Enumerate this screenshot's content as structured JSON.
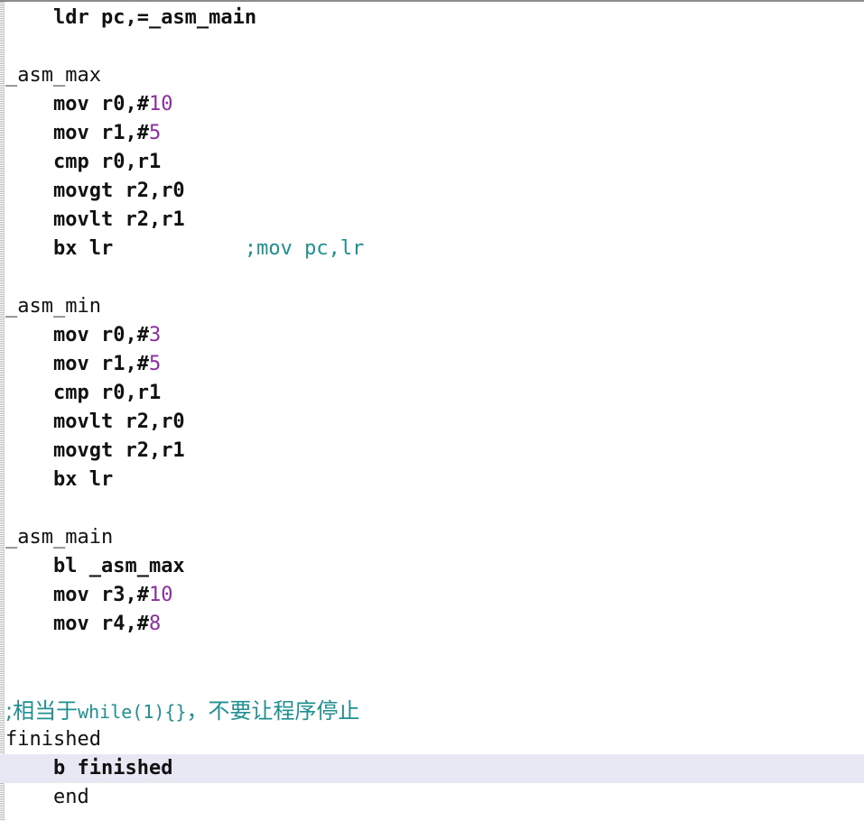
{
  "editor": {
    "colors": {
      "text": "#111111",
      "number": "#8b2fa0",
      "comment": "#1f8f8f",
      "current_line_bg": "#e8e8f5"
    },
    "lines": [
      {
        "indent": "    ",
        "code": "ldr pc,=_asm_main"
      },
      {
        "indent": "",
        "code": ""
      },
      {
        "indent": "",
        "label": "_asm_max"
      },
      {
        "indent": "    ",
        "code": "mov r0,#",
        "num": "10"
      },
      {
        "indent": "    ",
        "code": "mov r1,#",
        "num": "5"
      },
      {
        "indent": "    ",
        "code": "cmp r0,r1"
      },
      {
        "indent": "    ",
        "code": "movgt r2,r0"
      },
      {
        "indent": "    ",
        "code": "movlt r2,r1"
      },
      {
        "indent": "    ",
        "code": "bx lr",
        "pad": "           ",
        "comment": ";mov pc,lr"
      },
      {
        "indent": "",
        "code": ""
      },
      {
        "indent": "",
        "label": "_asm_min"
      },
      {
        "indent": "    ",
        "code": "mov r0,#",
        "num": "3"
      },
      {
        "indent": "    ",
        "code": "mov r1,#",
        "num": "5"
      },
      {
        "indent": "    ",
        "code": "cmp r0,r1"
      },
      {
        "indent": "    ",
        "code": "movlt r2,r0"
      },
      {
        "indent": "    ",
        "code": "movgt r2,r1"
      },
      {
        "indent": "    ",
        "code": "bx lr"
      },
      {
        "indent": "",
        "code": ""
      },
      {
        "indent": "",
        "label": "_asm_main"
      },
      {
        "indent": "    ",
        "code": "bl _asm_max"
      },
      {
        "indent": "    ",
        "code": "mov r3,#",
        "num": "10"
      },
      {
        "indent": "    ",
        "code": "mov r4,#",
        "num": "8"
      },
      {
        "indent": "",
        "code": ""
      },
      {
        "indent": "",
        "code": ""
      },
      {
        "indent": "",
        "comment_cjk_a": ";相当于",
        "comment_mono": "while(1){}",
        "comment_cjk_b": "，不要让程序停止"
      },
      {
        "indent": "",
        "label": "finished"
      },
      {
        "indent": "    ",
        "code": "b finished",
        "current": true
      },
      {
        "indent": "    ",
        "plain": "end"
      }
    ]
  }
}
